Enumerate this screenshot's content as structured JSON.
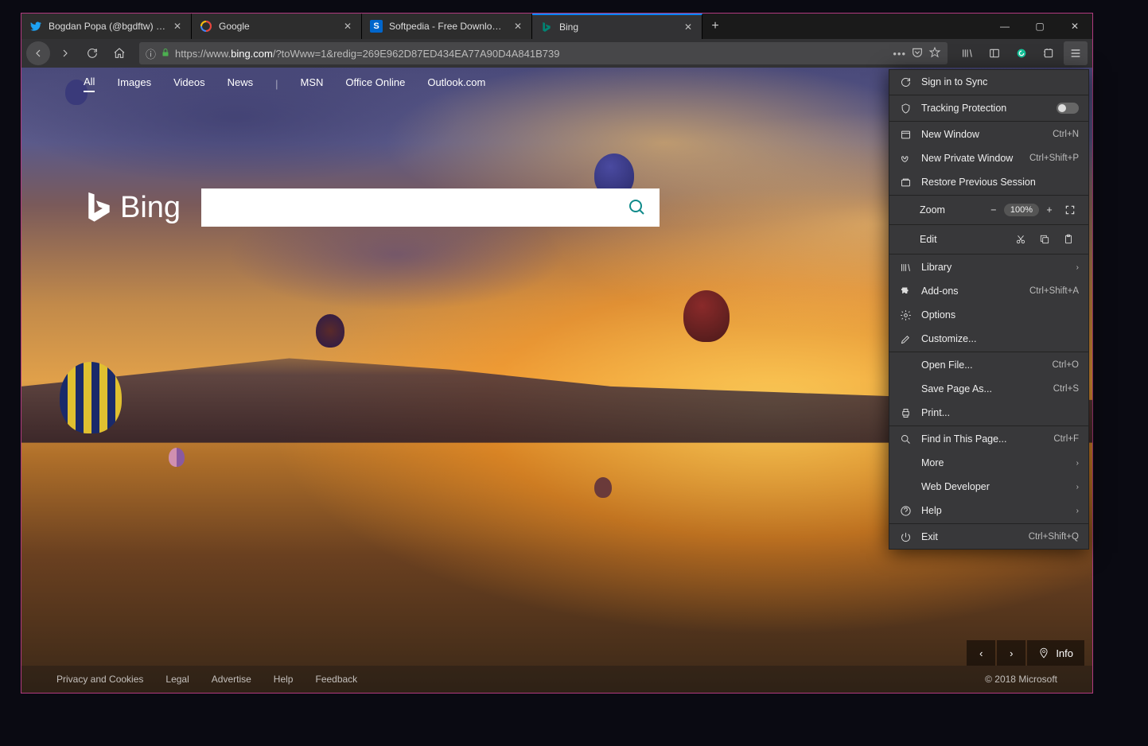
{
  "tabs": [
    {
      "favicon": "twitter",
      "title": "Bogdan Popa (@bgdftw) | Twit"
    },
    {
      "favicon": "google",
      "title": "Google"
    },
    {
      "favicon": "softpedia",
      "title": "Softpedia - Free Downloads En"
    },
    {
      "favicon": "bing",
      "title": "Bing",
      "active": true
    }
  ],
  "url": {
    "prefix": "https://www.",
    "domain": "bing.com",
    "path": "/?toWww=1&redig=269E962D87ED434EA77A90D4A841B739"
  },
  "bing_nav": [
    "All",
    "Images",
    "Videos",
    "News"
  ],
  "bing_nav2": [
    "MSN",
    "Office Online",
    "Outlook.com"
  ],
  "bing_logo": "Bing",
  "search_placeholder": "",
  "info_label": "Info",
  "footer": {
    "links": [
      "Privacy and Cookies",
      "Legal",
      "Advertise",
      "Help",
      "Feedback"
    ],
    "copyright": "© 2018 Microsoft"
  },
  "menu": {
    "sign_in": "Sign in to Sync",
    "tracking": "Tracking Protection",
    "new_window": {
      "label": "New Window",
      "shortcut": "Ctrl+N"
    },
    "private": {
      "label": "New Private Window",
      "shortcut": "Ctrl+Shift+P"
    },
    "restore": "Restore Previous Session",
    "zoom": {
      "label": "Zoom",
      "value": "100%"
    },
    "edit": "Edit",
    "library": "Library",
    "addons": {
      "label": "Add-ons",
      "shortcut": "Ctrl+Shift+A"
    },
    "options": "Options",
    "customize": "Customize...",
    "open_file": {
      "label": "Open File...",
      "shortcut": "Ctrl+O"
    },
    "save_page": {
      "label": "Save Page As...",
      "shortcut": "Ctrl+S"
    },
    "print": "Print...",
    "find": {
      "label": "Find in This Page...",
      "shortcut": "Ctrl+F"
    },
    "more": "More",
    "webdev": "Web Developer",
    "help": "Help",
    "exit": {
      "label": "Exit",
      "shortcut": "Ctrl+Shift+Q"
    }
  }
}
